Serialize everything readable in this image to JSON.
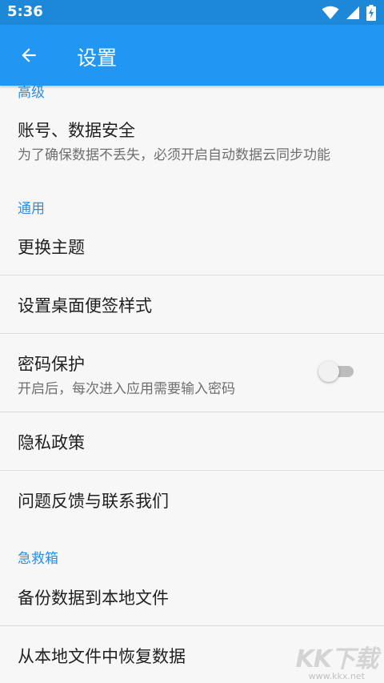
{
  "status_bar": {
    "time": "5:36",
    "icons": [
      "wifi-icon",
      "cell-signal-icon",
      "battery-charging-icon"
    ]
  },
  "app_bar": {
    "title": "设置",
    "back_icon": "arrow-back-icon"
  },
  "sections": {
    "advanced": {
      "header": "高级"
    },
    "general": {
      "header": "通用"
    },
    "emergency": {
      "header": "急救箱"
    }
  },
  "items": {
    "account": {
      "title": "账号、数据安全",
      "subtitle": "为了确保数据不丢失，必须开启自动数据云同步功能"
    },
    "theme": {
      "title": "更换主题"
    },
    "widget_style": {
      "title": "设置桌面便签样式"
    },
    "password": {
      "title": "密码保护",
      "subtitle": "开启后，每次进入应用需要输入密码",
      "enabled": false
    },
    "privacy": {
      "title": "隐私政策"
    },
    "feedback": {
      "title": "问题反馈与联系我们"
    },
    "backup": {
      "title": "备份数据到本地文件"
    },
    "restore": {
      "title": "从本地文件中恢复数据"
    }
  },
  "watermark": {
    "logo": "KK下载",
    "url": "www.kkx.net"
  },
  "colors": {
    "status_bar": "#1e88d8",
    "app_bar": "#2196f3",
    "section_header": "#2f8ee0",
    "background": "#f7f7f7"
  }
}
